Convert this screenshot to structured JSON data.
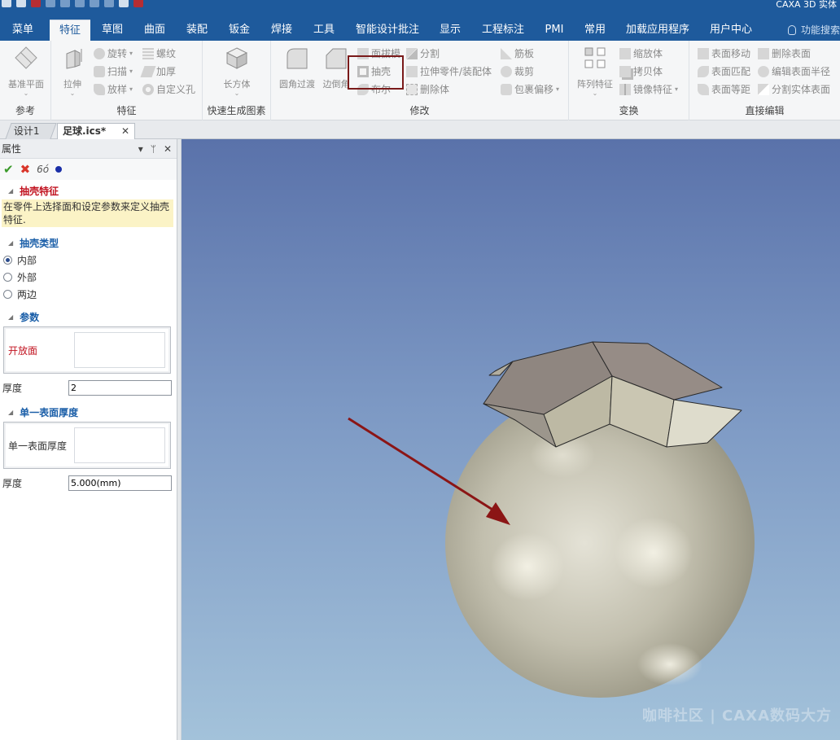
{
  "app": {
    "title": "CAXA 3D 实体"
  },
  "menu_tabs": [
    {
      "label": "菜单"
    },
    {
      "label": "特征"
    },
    {
      "label": "草图"
    },
    {
      "label": "曲面"
    },
    {
      "label": "装配"
    },
    {
      "label": "钣金"
    },
    {
      "label": "焊接"
    },
    {
      "label": "工具"
    },
    {
      "label": "智能设计批注"
    },
    {
      "label": "显示"
    },
    {
      "label": "工程标注"
    },
    {
      "label": "PMI"
    },
    {
      "label": "常用"
    },
    {
      "label": "加载应用程序"
    },
    {
      "label": "用户中心"
    }
  ],
  "search": {
    "label": "功能搜索"
  },
  "ribbon": {
    "groups": {
      "reference": "参考",
      "feature": "特征",
      "quick": "快速生成图素",
      "modify": "修改",
      "transform": "变换",
      "direct_edit": "直接编辑"
    },
    "base_plane": "基准平面",
    "extrude": "拉伸",
    "revolve": "旋转",
    "sweep": "扫描",
    "loft": "放样",
    "thread": "螺纹",
    "thicken": "加厚",
    "custom_hole": "自定义孔",
    "box": "长方体",
    "fillet": "圆角过渡",
    "chamfer": "边倒角",
    "draft": "面拔模",
    "shell": "抽壳",
    "cover": "布尔",
    "split": "分割",
    "stretch_part": "拉伸零件/装配体",
    "delete_body": "删除体",
    "rib": "筋板",
    "trim": "裁剪",
    "wrap_offset": "包裹偏移",
    "pattern": "阵列特征",
    "scale": "缩放体",
    "copy_body": "拷贝体",
    "mirror": "镜像特征",
    "face_move": "表面移动",
    "face_match": "表面匹配",
    "face_equidistant": "表面等距",
    "delete_face": "删除表面",
    "edit_face_radius": "编辑表面半径",
    "split_face": "分割实体表面"
  },
  "doc_tabs": [
    {
      "label": "设计1"
    },
    {
      "label": "足球.ics*"
    }
  ],
  "panel": {
    "title": "属性",
    "pin": "ᛘ",
    "close": "✕",
    "feature_title": "抽壳特征",
    "hint": "在零件上选择面和设定参数来定义抽壳特征.",
    "shell_type_title": "抽壳类型",
    "shell_types": [
      {
        "label": "内部",
        "checked": true
      },
      {
        "label": "外部",
        "checked": false
      },
      {
        "label": "两边",
        "checked": false
      }
    ],
    "params_title": "参数",
    "open_face_label": "开放面",
    "thickness_label": "厚度",
    "thickness_value": "2",
    "single_title": "单一表面厚度",
    "single_label": "单一表面厚度",
    "single_thickness_label": "厚度",
    "single_thickness_value": "5.000(mm)"
  },
  "viewport": {
    "watermark": "咖啡社区 | CAXA数码大方"
  },
  "colors": {
    "menubar": "#1e5a9c",
    "highlight_box": "#7a1a1a",
    "arrow": "#8b1515",
    "sphere": "#c4c0b0"
  }
}
